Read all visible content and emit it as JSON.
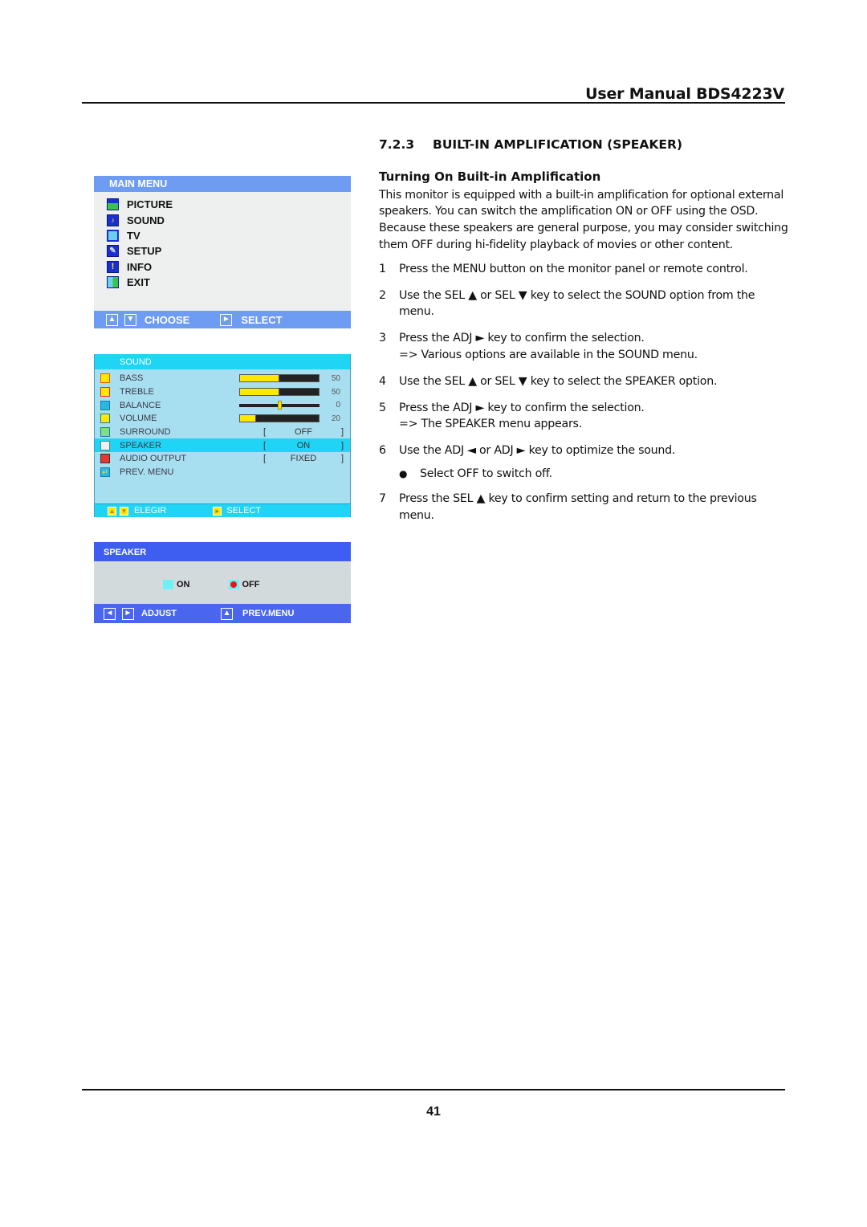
{
  "header": {
    "title": "User Manual BDS4223V"
  },
  "footer": {
    "page_number": "41"
  },
  "section": {
    "number": "7.2.3",
    "title": "BUILT-IN AMPLIFICATION (SPEAKER)",
    "subheading": "Turning On Built-in Amplification",
    "intro": "This monitor is equipped with a built-in amplification for optional external speakers. You can switch the amplification ON or OFF using the OSD. Because these speakers are general purpose, you may consider switching them OFF during hi-fidelity playback of movies or other content.",
    "steps": [
      {
        "n": "1",
        "text": "Press the MENU button on the monitor panel or remote control."
      },
      {
        "n": "2",
        "text": "Use the SEL ▲ or SEL ▼ key to select the SOUND option from the menu."
      },
      {
        "n": "3",
        "text": "Press the ADJ ► key to confirm the selection.",
        "result": "=> Various options are available in the SOUND menu."
      },
      {
        "n": "4",
        "text": "Use the SEL ▲ or SEL ▼ key to select the SPEAKER option."
      },
      {
        "n": "5",
        "text": "Press the ADJ ► key to confirm the selection.",
        "result": "=> The SPEAKER menu appears."
      },
      {
        "n": "6",
        "text": "Use the ADJ ◄ or ADJ ►  key to optimize the sound."
      },
      {
        "n": "7",
        "text": "Press the SEL ▲ key to confirm setting and return to the previous menu."
      }
    ],
    "bullet": "Select OFF to switch off."
  },
  "main_menu": {
    "title": "MAIN  MENU",
    "items": [
      {
        "label": "PICTURE",
        "icon": "picture-icon"
      },
      {
        "label": "SOUND",
        "icon": "sound-icon"
      },
      {
        "label": "TV",
        "icon": "tv-icon"
      },
      {
        "label": "SETUP",
        "icon": "setup-icon"
      },
      {
        "label": "INFO",
        "icon": "info-icon"
      },
      {
        "label": "EXIT",
        "icon": "exit-icon"
      }
    ],
    "footer": {
      "choose": "CHOOSE",
      "select": "SELECT"
    }
  },
  "sound_menu": {
    "title": "SOUND",
    "items": [
      {
        "label": "BASS",
        "value": "50",
        "level": 50
      },
      {
        "label": "TREBLE",
        "value": "50",
        "level": 50
      },
      {
        "label": "BALANCE",
        "value": "0",
        "level": 50
      },
      {
        "label": "VOLUME",
        "value": "20",
        "level": 20
      },
      {
        "label": "SURROUND",
        "option": "OFF"
      },
      {
        "label": "SPEAKER",
        "option": "ON",
        "selected": true
      },
      {
        "label": "AUDIO OUTPUT",
        "option": "FIXED"
      },
      {
        "label": "PREV. MENU"
      }
    ],
    "footer": {
      "choose": "ELEGIR",
      "select": "SELECT"
    }
  },
  "speaker_menu": {
    "title": "SPEAKER",
    "options": [
      {
        "label": "ON",
        "selected": false
      },
      {
        "label": "OFF",
        "selected": true
      }
    ],
    "footer": {
      "adjust": "ADJUST",
      "prev": "PREV.MENU"
    }
  },
  "colors": {
    "main_menu_bar": "#6e9cf2",
    "sound_menu_bar": "#20d4f6",
    "speaker_menu_bar": "#3d5ef0",
    "slider_fill": "#ffe800",
    "selected_dot": "#ee1111"
  }
}
